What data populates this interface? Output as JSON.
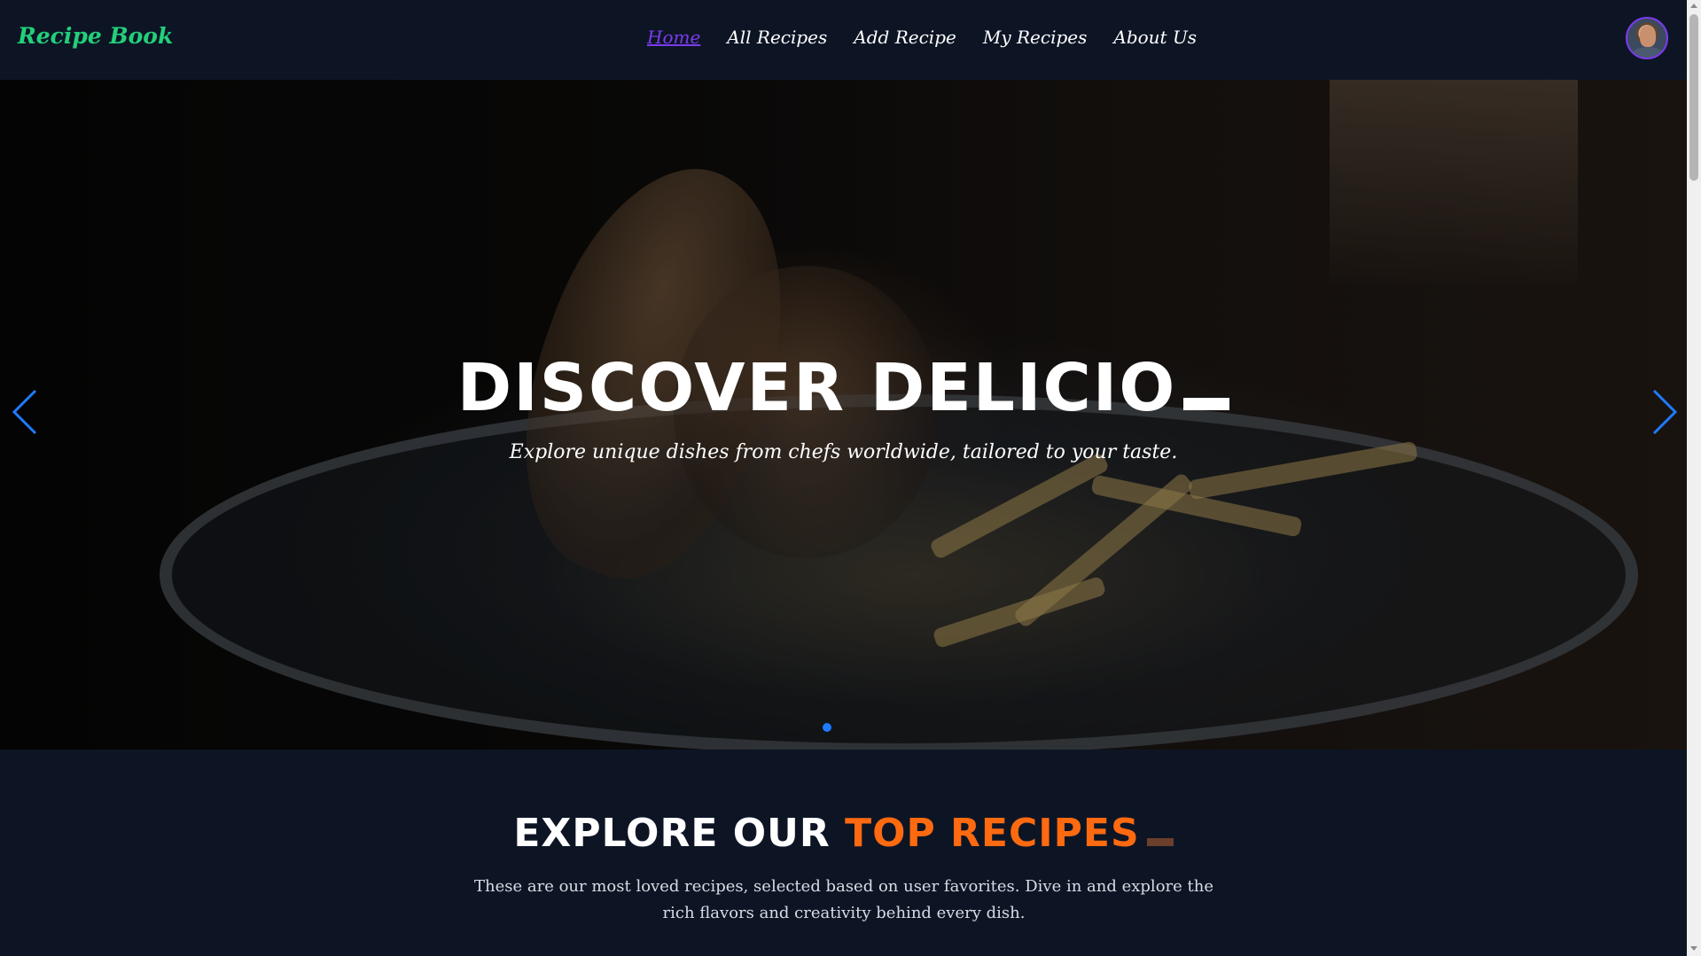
{
  "navbar": {
    "brand": "Recipe Book",
    "links": [
      {
        "label": "Home",
        "active": true
      },
      {
        "label": "All Recipes",
        "active": false
      },
      {
        "label": "Add Recipe",
        "active": false
      },
      {
        "label": "My Recipes",
        "active": false
      },
      {
        "label": "About Us",
        "active": false
      }
    ],
    "avatar_icon": "user-avatar-photo"
  },
  "hero": {
    "title": "DISCOVER DELICIO",
    "subtitle": "Explore unique dishes from chefs worldwide, tailored to your taste.",
    "prev_icon": "chevron-left-icon",
    "next_icon": "chevron-right-icon",
    "slides_count": 1,
    "active_slide": 1
  },
  "top_recipes": {
    "title_white": "EXPLORE OUR ",
    "title_accent": "TOP RECIPES",
    "description": "These are our most loved recipes, selected based on user favorites. Dive in and explore the rich flavors and creativity behind every dish."
  },
  "colors": {
    "background": "#0d1525",
    "brand": "#22d07a",
    "active_link": "#7c3aed",
    "accent": "#ff6a10",
    "carousel": "#1e7bff"
  }
}
